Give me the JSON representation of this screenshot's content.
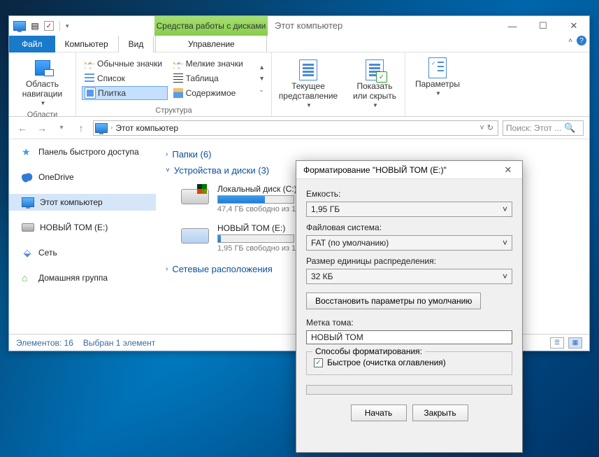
{
  "window": {
    "ctx_tab": "Средства работы с дисками",
    "ctx_label": "Этот компьютер",
    "minimize": "—",
    "maximize": "☐",
    "close": "✕"
  },
  "menu": {
    "file": "Файл",
    "computer": "Компьютер",
    "view": "Вид",
    "manage": "Управление"
  },
  "ribbon": {
    "nav_area": "Область навигации",
    "nav_group": "Области",
    "icons_normal": "Обычные значки",
    "icons_small": "Мелкие значки",
    "list": "Список",
    "table": "Таблица",
    "tile": "Плитка",
    "content": "Содержимое",
    "structure_group": "Структура",
    "current_view": "Текущее представление",
    "show_hide": "Показать или скрыть",
    "params": "Параметры"
  },
  "address": {
    "path": "Этот компьютер",
    "search_placeholder": "Поиск: Этот ..."
  },
  "nav": {
    "quick": "Панель быстрого доступа",
    "onedrive": "OneDrive",
    "thispc": "Этот компьютер",
    "newvol": "НОВЫЙ ТОМ (E:)",
    "network": "Сеть",
    "homegroup": "Домашняя группа"
  },
  "sections": {
    "folders": "Папки (6)",
    "devices": "Устройства и диски (3)",
    "netloc": "Сетевые расположения"
  },
  "drives": [
    {
      "name": "Локальный диск (C:)",
      "free": "47,4 ГБ свободно из 1",
      "fill": 62
    },
    {
      "name": "НОВЫЙ ТОМ (E:)",
      "free": "1,95 ГБ свободно из 1,",
      "fill": 4
    }
  ],
  "status": {
    "elements": "Элементов: 16",
    "selected": "Выбран 1 элемент"
  },
  "dialog": {
    "title": "Форматирование \"НОВЫЙ ТОМ (E:)\"",
    "capacity_label": "Емкость:",
    "capacity_value": "1,95 ГБ",
    "fs_label": "Файловая система:",
    "fs_value": "FAT (по умолчанию)",
    "alloc_label": "Размер единицы распределения:",
    "alloc_value": "32 КБ",
    "restore": "Восстановить параметры по умолчанию",
    "volume_label": "Метка тома:",
    "volume_value": "НОВЫЙ ТОМ",
    "format_opts": "Способы форматирования:",
    "quick": "Быстрое (очистка оглавления)",
    "start": "Начать",
    "close": "Закрыть"
  }
}
